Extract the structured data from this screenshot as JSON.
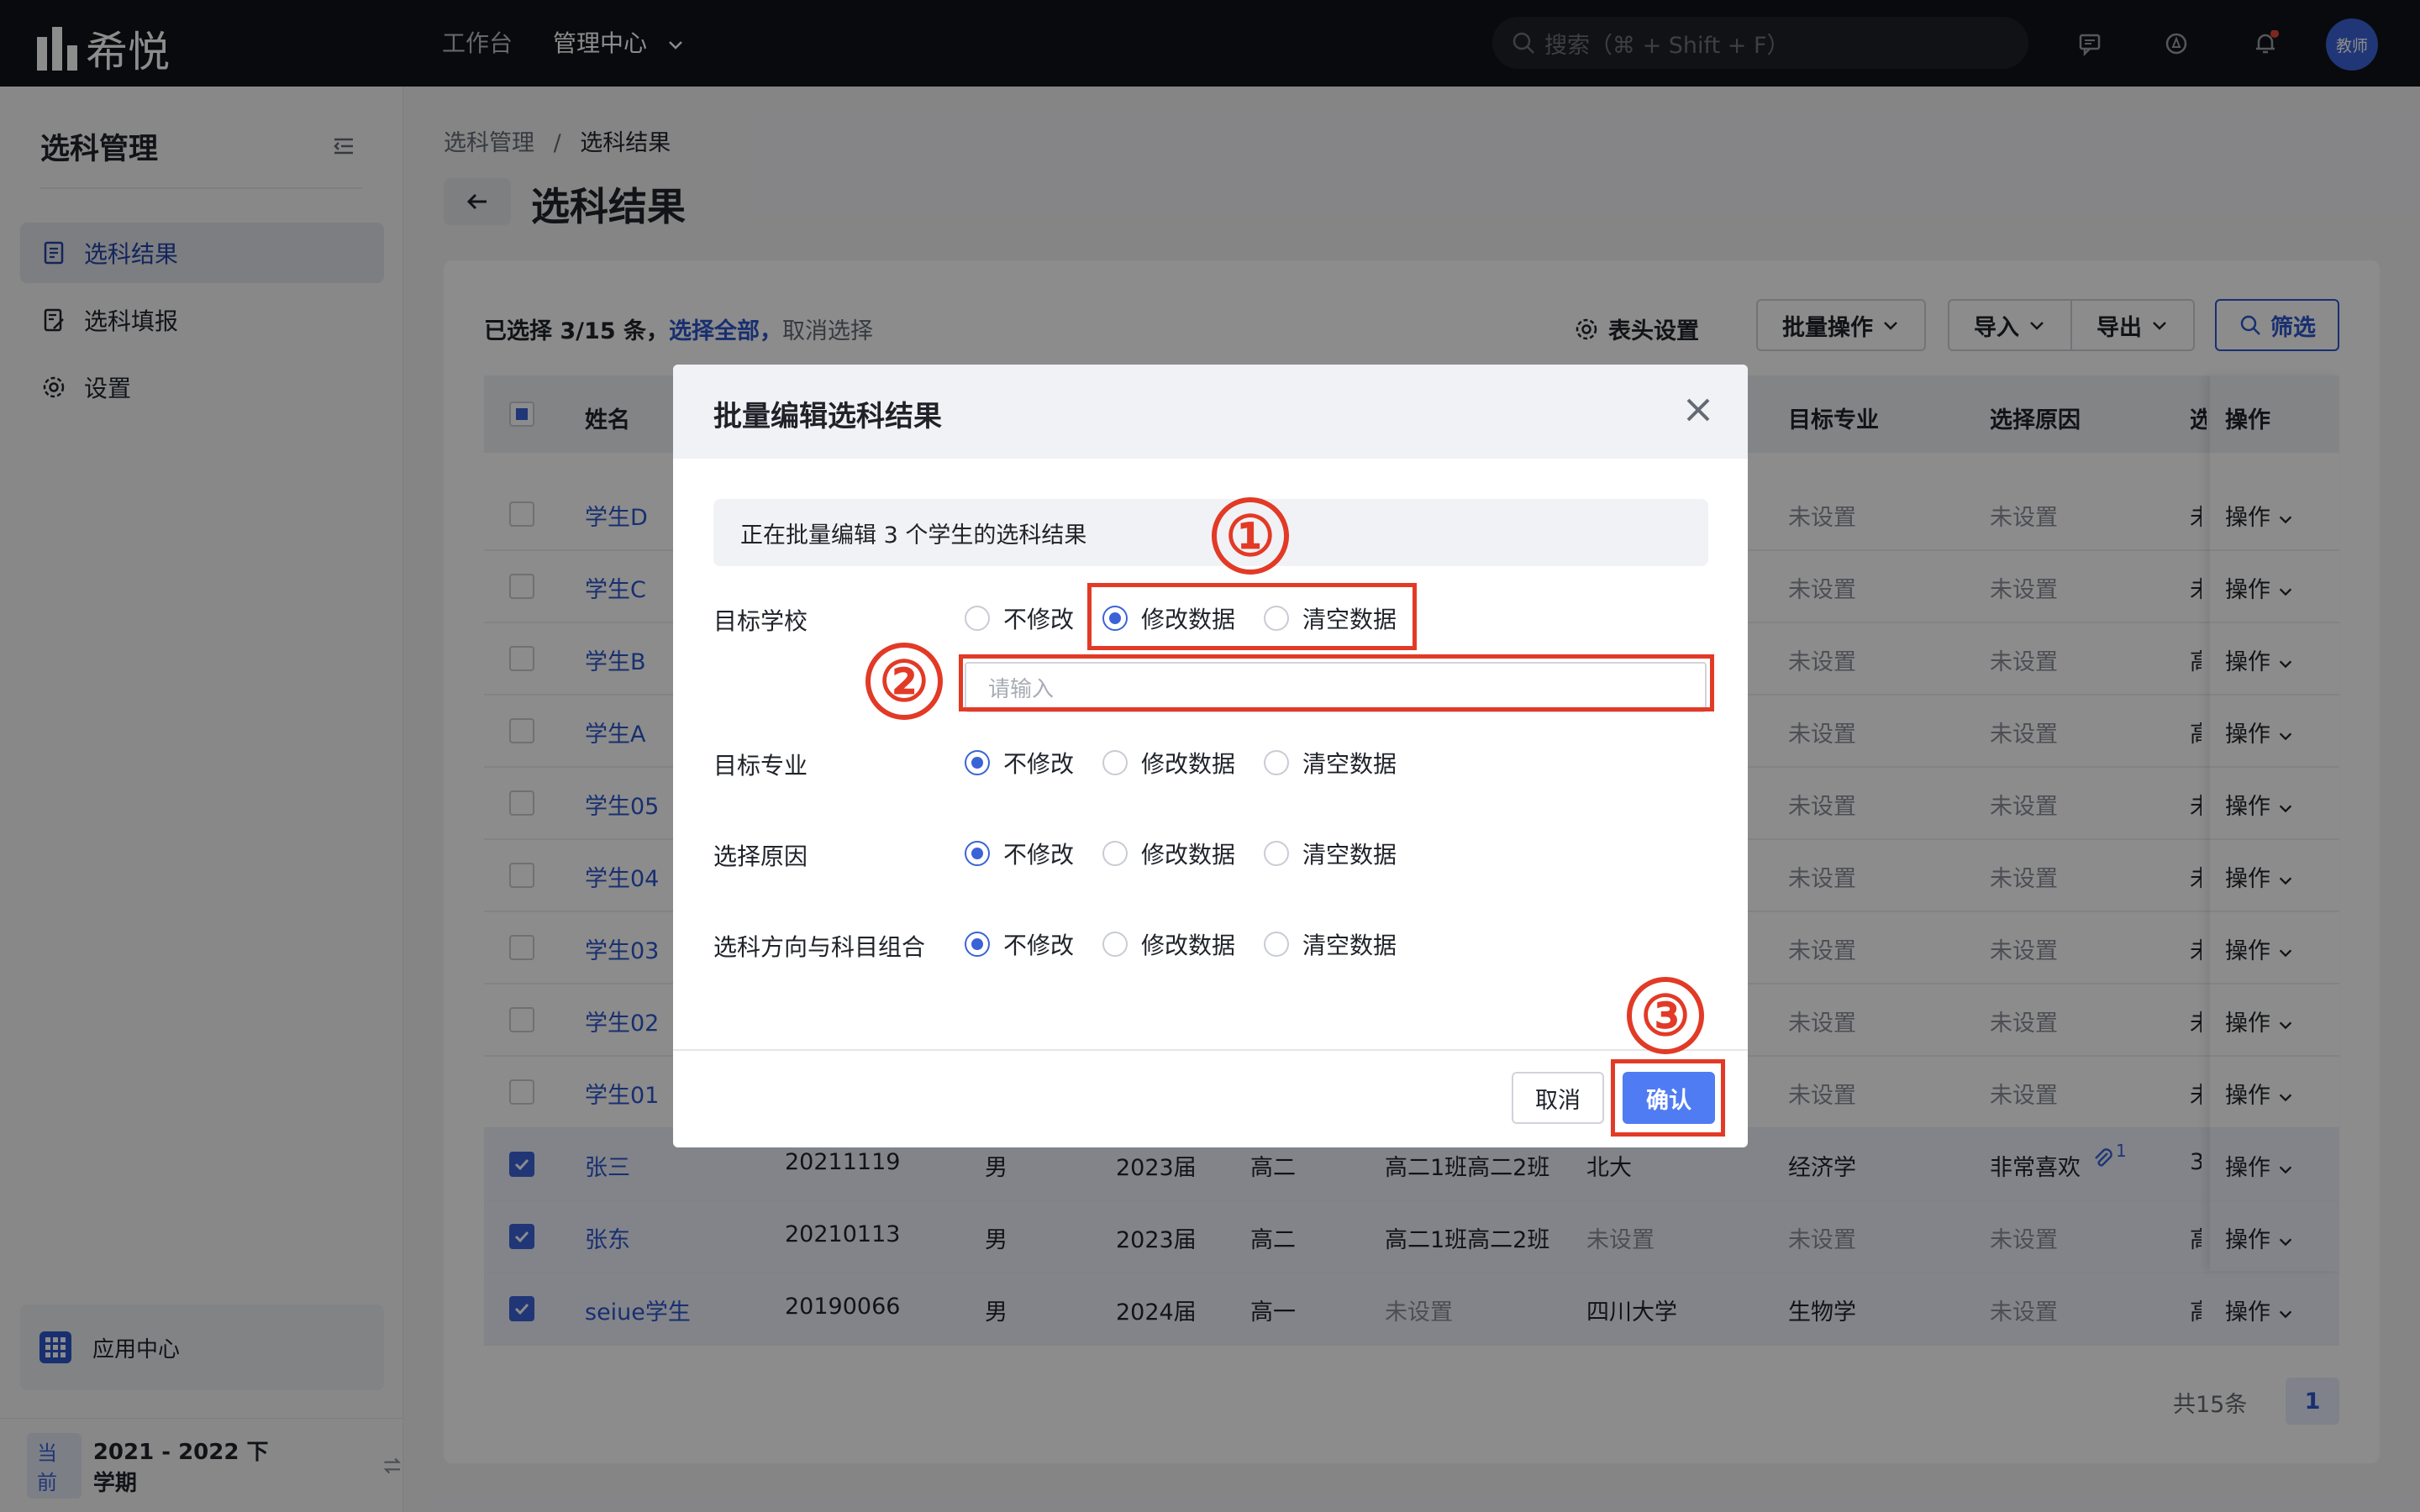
{
  "topbar": {
    "logo_text": "希悦",
    "nav": [
      "工作台",
      "管理中心"
    ],
    "search_placeholder": "搜索（⌘ + Shift + F）",
    "avatar_label": "教师"
  },
  "sidebar": {
    "title": "选科管理",
    "items": [
      {
        "label": "选科结果",
        "icon": "document-icon",
        "active": true
      },
      {
        "label": "选科填报",
        "icon": "form-edit-icon",
        "active": false
      },
      {
        "label": "设置",
        "icon": "gear-icon",
        "active": false
      }
    ],
    "app_center": "应用中心",
    "term_tag": "当前",
    "term": "2021 - 2022 下学期"
  },
  "main": {
    "breadcrumb": [
      "选科管理",
      "/",
      "选科结果"
    ],
    "title": "选科结果",
    "selection": {
      "count_text": "已选择 3/15 条，",
      "select_all": "选择全部，",
      "cancel": "取消选择"
    },
    "toolbar": {
      "header_settings": "表头设置",
      "batch": "批量操作",
      "import": "导入",
      "export": "导出",
      "filter": "筛选"
    },
    "columns": [
      "姓名",
      "目标专业",
      "选择原因",
      "选",
      "操作"
    ],
    "rows": [
      {
        "name": "学生D",
        "checked": false,
        "cells": [
          "",
          "",
          "",
          "",
          "",
          "",
          "",
          "未设置",
          "未设置",
          "未"
        ]
      },
      {
        "name": "学生C",
        "checked": false,
        "cells": [
          "",
          "",
          "",
          "",
          "",
          "",
          "",
          "未设置",
          "未设置",
          "未"
        ]
      },
      {
        "name": "学生B",
        "checked": false,
        "cells": [
          "",
          "",
          "",
          "",
          "",
          "",
          "",
          "未设置",
          "未设置",
          "高"
        ]
      },
      {
        "name": "学生A",
        "checked": false,
        "cells": [
          "",
          "",
          "",
          "",
          "",
          "",
          "",
          "未设置",
          "未设置",
          "高"
        ]
      },
      {
        "name": "学生05",
        "checked": false,
        "cells": [
          "",
          "",
          "",
          "",
          "",
          "",
          "",
          "未设置",
          "未设置",
          "未"
        ]
      },
      {
        "name": "学生04",
        "checked": false,
        "cells": [
          "",
          "",
          "",
          "",
          "",
          "",
          "",
          "未设置",
          "未设置",
          "未"
        ]
      },
      {
        "name": "学生03",
        "checked": false,
        "cells": [
          "",
          "",
          "",
          "",
          "",
          "",
          "",
          "未设置",
          "未设置",
          "未"
        ]
      },
      {
        "name": "学生02",
        "checked": false,
        "cells": [
          "",
          "",
          "",
          "",
          "",
          "",
          "",
          "未设置",
          "未设置",
          "未"
        ]
      },
      {
        "name": "学生01",
        "checked": false,
        "cells": [
          "",
          "",
          "",
          "",
          "",
          "",
          "",
          "未设置",
          "未设置",
          "未"
        ]
      },
      {
        "name": "张三",
        "checked": true,
        "cells": [
          "20211119",
          "男",
          "2023届",
          "高二",
          "高二1班高二2班",
          "北大",
          "",
          "经济学",
          "非常喜欢",
          "3"
        ]
      },
      {
        "name": "张东",
        "checked": true,
        "cells": [
          "20210113",
          "男",
          "2023届",
          "高二",
          "高二1班高二2班",
          "未设置",
          "",
          "未设置",
          "未设置",
          "高"
        ]
      },
      {
        "name": "seiue学生",
        "checked": true,
        "cells": [
          "20190066",
          "男",
          "2024届",
          "高一",
          "未设置",
          "四川大学",
          "",
          "生物学",
          "未设置",
          "高"
        ]
      }
    ],
    "row_action": "操作",
    "attachment_count": "1",
    "pager": {
      "total": "共15条",
      "page": "1"
    }
  },
  "modal": {
    "title": "批量编辑选科结果",
    "notice": "正在批量编辑 3 个学生的选科结果",
    "options": [
      "不修改",
      "修改数据",
      "清空数据"
    ],
    "fields": [
      {
        "label": "目标学校",
        "selected": 1
      },
      {
        "label": "目标专业",
        "selected": 0
      },
      {
        "label": "选择原因",
        "selected": 0
      },
      {
        "label": "选科方向与科目组合",
        "selected": 0
      }
    ],
    "input_placeholder": "请输入",
    "cancel": "取消",
    "confirm": "确认"
  },
  "annotations": [
    "①",
    "②",
    "③"
  ],
  "colors": {
    "accent": "#3b63d8",
    "annotation": "#e23a26",
    "topbar": "#111318"
  }
}
